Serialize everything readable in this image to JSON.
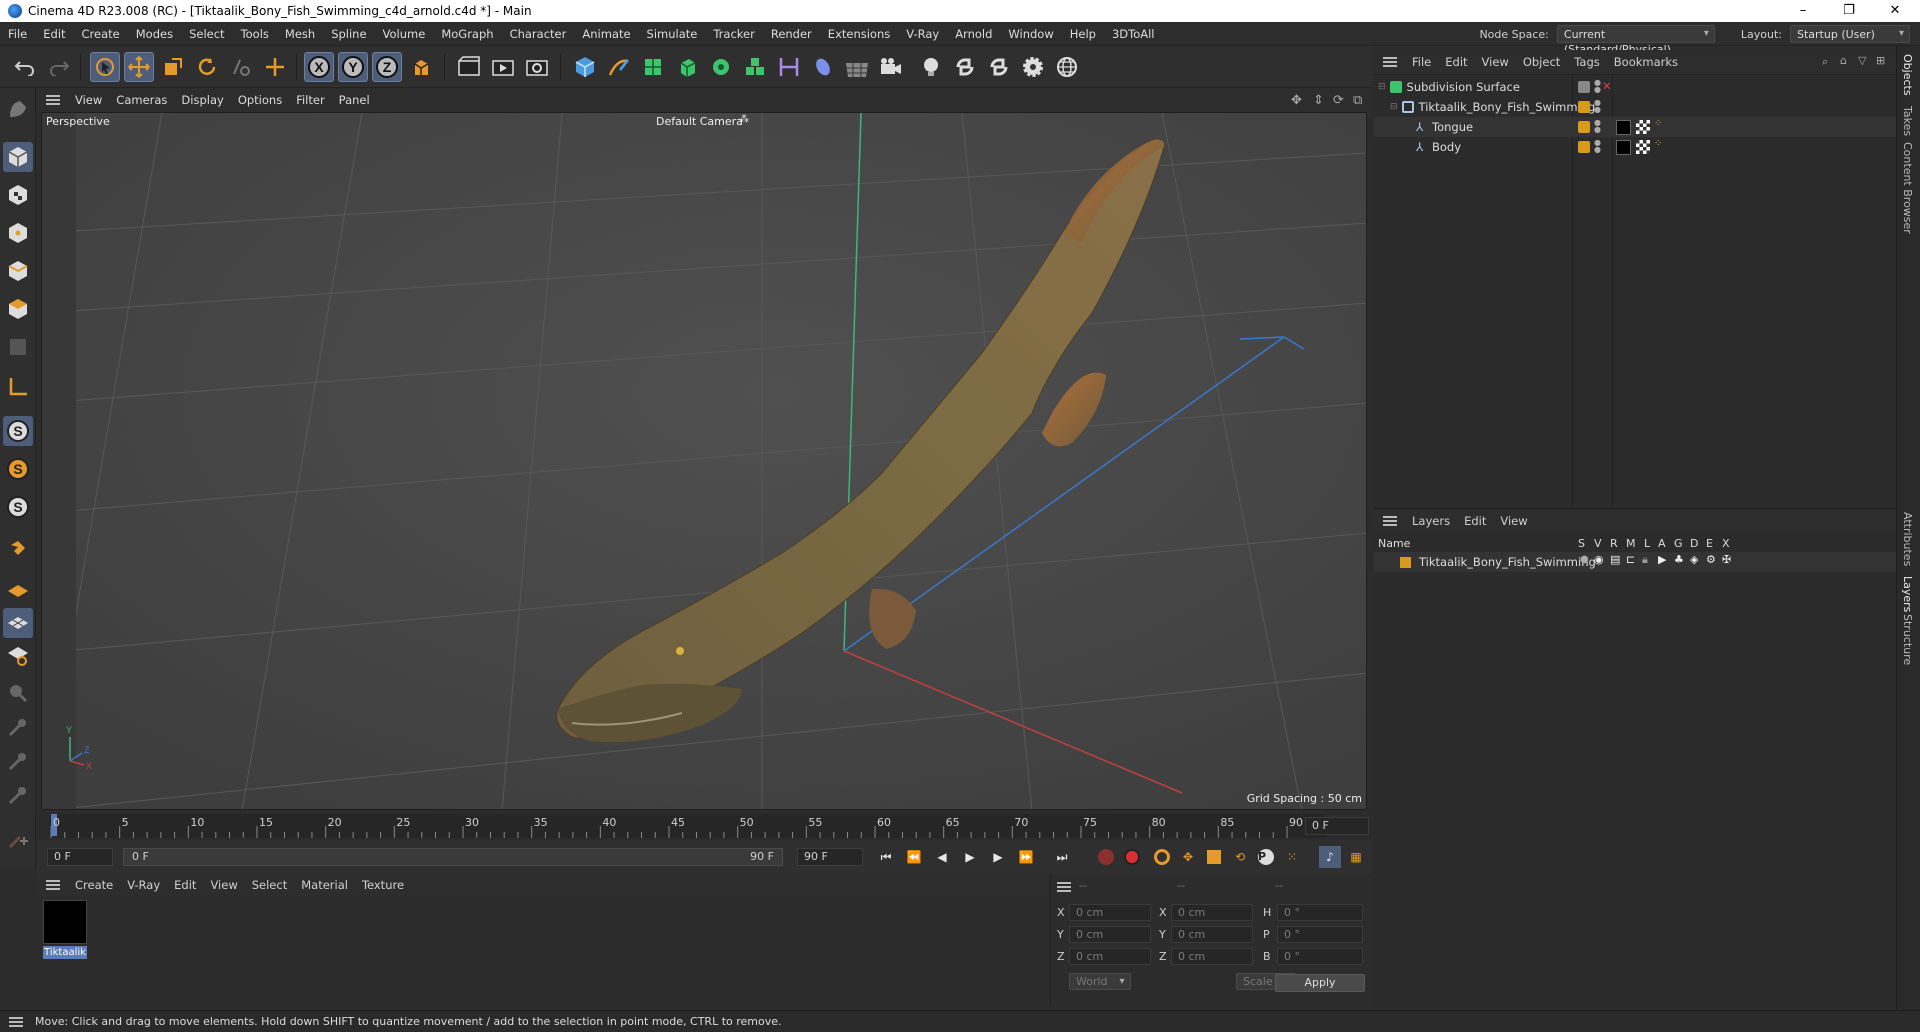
{
  "window": {
    "title": "Cinema 4D R23.008 (RC) - [Tiktaalik_Bony_Fish_Swimming_c4d_arnold.c4d *] - Main",
    "controls": [
      "–",
      "❐",
      "✕"
    ]
  },
  "menubar": {
    "items": [
      "File",
      "Edit",
      "Create",
      "Modes",
      "Select",
      "Tools",
      "Mesh",
      "Spline",
      "Volume",
      "MoGraph",
      "Character",
      "Animate",
      "Simulate",
      "Tracker",
      "Render",
      "Extensions",
      "V-Ray",
      "Arnold",
      "Window",
      "Help",
      "3DToAll"
    ],
    "node_space_label": "Node Space:",
    "node_space_value": "Current (Standard/Physical)",
    "layout_label": "Layout:",
    "layout_value": "Startup (User)"
  },
  "toolbar": {
    "icons": [
      "undo-icon",
      "redo-icon",
      "select-icon",
      "move-icon",
      "scale-icon",
      "rotate-icon",
      "recent-icon",
      "add-icon",
      "axis-x-icon",
      "axis-y-icon",
      "axis-z-icon",
      "coordinate-icon",
      "render-region-icon",
      "render-view-icon",
      "render-settings-icon",
      "cube-icon",
      "pen-icon",
      "subdivision-icon",
      "extrude-icon",
      "cloner-icon",
      "mograph-icon",
      "deformer-icon",
      "field-icon",
      "floor-icon",
      "camera-icon",
      "light-icon",
      "python-icon",
      "python2-icon",
      "gear-icon",
      "globe-icon"
    ]
  },
  "viewport": {
    "menu": [
      "View",
      "Cameras",
      "Display",
      "Options",
      "Filter",
      "Panel"
    ],
    "view_label": "Perspective",
    "camera_label": "Default Camera",
    "grid_spacing": "Grid Spacing : 50 cm"
  },
  "timeline": {
    "ticks": [
      "0",
      "5",
      "10",
      "15",
      "20",
      "25",
      "30",
      "35",
      "40",
      "45",
      "50",
      "55",
      "60",
      "65",
      "70",
      "75",
      "80",
      "85",
      "90"
    ],
    "current_frame": "0 F"
  },
  "playback": {
    "start": "0 F",
    "range_start": "0 F",
    "range_end": "90 F",
    "end": "90 F"
  },
  "material_panel": {
    "menu": [
      "Create",
      "V-Ray",
      "Edit",
      "View",
      "Select",
      "Material",
      "Texture"
    ],
    "materials": [
      {
        "name": "Tiktaalik",
        "color": "#000000"
      }
    ]
  },
  "coordinates": {
    "header": [
      "--",
      "--",
      "--"
    ],
    "rows": [
      {
        "l1": "X",
        "v1": "0 cm",
        "l2": "X",
        "v2": "0 cm",
        "l3": "H",
        "v3": "0 °"
      },
      {
        "l1": "Y",
        "v1": "0 cm",
        "l2": "Y",
        "v2": "0 cm",
        "l3": "P",
        "v3": "0 °"
      },
      {
        "l1": "Z",
        "v1": "0 cm",
        "l2": "Z",
        "v2": "0 cm",
        "l3": "B",
        "v3": "0 °"
      }
    ],
    "space": "World",
    "mode": "Scale",
    "apply": "Apply"
  },
  "objects": {
    "menu": [
      "File",
      "Edit",
      "View",
      "Object",
      "Tags",
      "Bookmarks"
    ],
    "tree": [
      {
        "name": "Subdivision Surface",
        "indent": 0,
        "icon": "subdivision-icon"
      },
      {
        "name": "Tiktaalik_Bony_Fish_Swimming",
        "indent": 1,
        "icon": "null-icon"
      },
      {
        "name": "Tongue",
        "indent": 2,
        "icon": "bone-icon"
      },
      {
        "name": "Body",
        "indent": 2,
        "icon": "bone-icon"
      }
    ]
  },
  "layers": {
    "menu": [
      "Layers",
      "Edit",
      "View"
    ],
    "columns": [
      "Name",
      "S",
      "V",
      "R",
      "M",
      "L",
      "A",
      "G",
      "D",
      "E",
      "X"
    ],
    "rows": [
      {
        "name": "Tiktaalik_Bony_Fish_Swimming",
        "color": "#d89a1d"
      }
    ]
  },
  "side_tabs": [
    "Objects",
    "Takes",
    "Content Browser",
    "Attributes",
    "Layers",
    "Structure"
  ],
  "status": {
    "text": "Move: Click and drag to move elements. Hold down SHIFT to quantize movement / add to the selection in point mode, CTRL to remove."
  },
  "colors": {
    "accent": "#4e5e7a",
    "orange": "#e59a2b",
    "bg": "#2c2c2c",
    "layer": "#d89a1d"
  }
}
